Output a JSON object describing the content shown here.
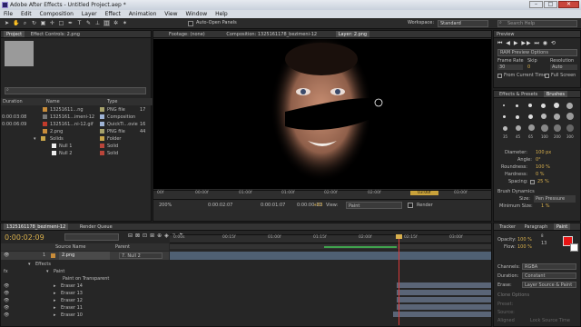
{
  "window": {
    "title": "Adobe After Effects - Untitled Project.aep *",
    "min": "–",
    "max": "□",
    "close": "✕"
  },
  "menu": [
    "File",
    "Edit",
    "Composition",
    "Layer",
    "Effect",
    "Animation",
    "View",
    "Window",
    "Help"
  ],
  "toolbar": {
    "auto_open": "Auto-Open Panels",
    "workspace_label": "Workspace:",
    "workspace_value": "Standard",
    "search_placeholder": "Search Help"
  },
  "project": {
    "tab": "Project",
    "effect_controls_tab": "Effect Controls: 2.png",
    "col_name": "Name",
    "col_type": "Type",
    "col_duration": "Duration",
    "items": [
      {
        "name": "13251611...ng",
        "type": "PNG file",
        "dur": "",
        "color": "#a7a26b"
      },
      {
        "name": "1325161...imeni-12",
        "type": "Composition",
        "dur": "0:00:03:08",
        "color": "#9fb4d6"
      },
      {
        "name": "1325161...ni-12.gif",
        "type": "QuickTi...ovie",
        "dur": "0:00:06:09",
        "color": "#9fb4d6"
      },
      {
        "name": "2.png",
        "type": "PNG file",
        "dur": "",
        "color": "#a7a26b"
      },
      {
        "name": "Solids",
        "type": "Folder",
        "dur": "",
        "color": "#c9a64a"
      },
      {
        "name": "Null 1",
        "type": "Solid",
        "dur": "",
        "color": "#b9453a"
      },
      {
        "name": "Null 2",
        "type": "Solid",
        "dur": "",
        "color": "#b9453a"
      }
    ],
    "numbers": [
      "17",
      "16",
      "44"
    ]
  },
  "viewer": {
    "footage_tab": "Footage: (none)",
    "comp_tab": "Composition: 1325161178_bezimeni-12",
    "layer_tab": "Layer: 2.png",
    "ticks": [
      "00f",
      "00:00f",
      "01:00f",
      "01:00f",
      "02:00f",
      "02:00f",
      "03:00f",
      "03:00f"
    ],
    "zoom": "200%",
    "time1": "0:00:02:07",
    "time2": "0:00:01:07",
    "time3": "0:00:00:10",
    "plus": "+63",
    "view_label": "View:",
    "view_value": "Paint",
    "render": "Render"
  },
  "preview": {
    "title": "Preview",
    "ram": "RAM Preview Options",
    "frame_rate": "Frame Rate",
    "skip": "Skip",
    "resolution": "Resolution",
    "fr_val": "30",
    "skip_val": "0",
    "res_val": "Auto",
    "from_current": "From Current Time",
    "full_screen": "Full Screen"
  },
  "brushes": {
    "tab1": "Effects & Presets",
    "tab2": "Brushes",
    "sizes": [
      "1",
      "3",
      "5",
      "9",
      "13",
      "19",
      "5",
      "9",
      "13",
      "17",
      "21",
      "27",
      "35",
      "45",
      "65",
      "100",
      "200",
      "300"
    ],
    "diameter": "Diameter:",
    "diameter_val": "100 px",
    "angle": "Angle:",
    "angle_val": "0°",
    "roundness": "Roundness:",
    "roundness_val": "100 %",
    "hardness": "Hardness:",
    "hardness_val": "0 %",
    "spacing": "Spacing:",
    "spacing_val": "25 %",
    "dynamics": "Brush Dynamics",
    "size": "Size:",
    "size_val": "Pen Pressure",
    "min_size": "Minimum Size:",
    "min_size_val": "1 %"
  },
  "paint": {
    "tabs": [
      "Tracker",
      "Paragraph",
      "Paint"
    ],
    "opacity": "Opacity:",
    "opacity_val": "100 %",
    "flow": "Flow:",
    "flow_val": "100 %",
    "channels": "Channels:",
    "channels_val": "RGBA",
    "duration": "Duration:",
    "duration_val": "Constant",
    "erase": "Erase:",
    "erase_val": "Layer Source & Paint",
    "clone": "Clone Options",
    "preset": "Preset:",
    "source": "Source:",
    "aligned": "Aligned",
    "lock_source": "Lock Source Time",
    "offset": "Offset:",
    "source_time": "Source Time Shift:",
    "color": "#e81414",
    "paint_n1": "13",
    "paint_n2": "8"
  },
  "timeline": {
    "tab": "1325161178_bezimeni-12",
    "render_queue": "Render Queue",
    "time": "0:00:02:09",
    "source_name": "Source Name",
    "parent": "Parent",
    "layer_num": "1",
    "layer_name": "2.png",
    "parent_val": "7. Null 2",
    "rows": [
      "Effects",
      "Paint",
      "Paint on Transparent",
      "Eraser 14",
      "Eraser 13",
      "Eraser 12",
      "Eraser 11",
      "Eraser 10"
    ],
    "ruler": [
      "0:00s",
      "00:15f",
      "01:00f",
      "01:15f",
      "02:00f",
      "02:15f",
      "03:00f"
    ]
  }
}
